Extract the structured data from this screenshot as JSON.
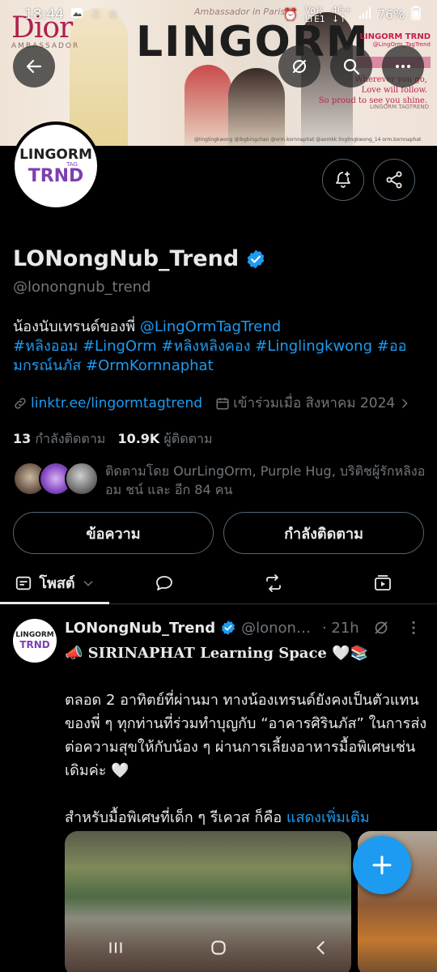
{
  "status_bar": {
    "time": "18:44",
    "signal_text_1": "Vo))",
    "signal_text_2": "LTE1",
    "net_1": "4G+",
    "net_2": "↓↑",
    "battery": "76%"
  },
  "banner": {
    "brand": "Dior",
    "brand_sub": "AMBASSADOR",
    "title": "LINGORM",
    "script": "Ambassador in Paris",
    "logo": "LINGORM TRND",
    "handle": "@LingOrm_TagTrend",
    "quote_lines": [
      "Wherever you go,",
      "Love will follow.",
      "So proud to see you shine."
    ],
    "tag": "LINGORM.TAGTREND",
    "handles": "@linglingkwong   @ibgbingchan   @orm.kornnaphat   @aomkk   linglingkwong_14   orm.kornnaphat"
  },
  "profile": {
    "logo_top": "LINGORM",
    "logo_tag": "TAG",
    "logo_bottom": "TRND",
    "name": "LONongNub_Trend",
    "handle": "@lonongnub_trend",
    "bio_text": "น้องนับเทรนด์ของพี่ ",
    "bio_mention": "@LingOrmTagTrend",
    "bio_tags_line1": "#หลิงออม #LingOrm  #หลิงหลิงคอง #Linglingkwong  #ออ",
    "bio_tags_line2": "มกรณ์นภัส #OrmKornnaphat",
    "link": "linktr.ee/lingormtagtrend",
    "joined": "เข้าร่วมเมื่อ สิงหาคม 2024",
    "following_count": "13",
    "following_label": "กำลังติดตาม",
    "followers_count": "10.9K",
    "followers_label": "ผู้ติดตาม",
    "followed_by": "ติดตามโดย OurLingOrm, Purple Hug, บริติชผู้รักหลิงออม ชน์ และ อีก 84 คน",
    "message_button": "ข้อความ",
    "following_button": "กำลังติดตาม"
  },
  "tabs": {
    "posts": "โพสต์"
  },
  "post": {
    "name": "LONongNub_Trend",
    "handle": "@lonon…",
    "time": "· 21h",
    "title": "📣 SIRINAPHAT Learning Space 🤍📚",
    "para1": "ตลอด 2 อาทิตย์ที่ผ่านมา ทางน้องเทรนด์ยังคงเป็นตัวแทนของพี่ ๆ ทุกท่านที่ร่วมทำบุญกับ “อาคารศิรินภัส” ในการส่งต่อความสุขให้กับน้อง ๆ ผ่านการเลี้ยงอาหารมื้อพิเศษเช่นเดิมค่ะ 🤍",
    "para2": "สำหรับมื้อพิเศษที่เด็ก ๆ รีเควส ก็คือ ",
    "show_more": "แสดงเพิ่มเติม"
  },
  "colors": {
    "accent": "#1d9bf0",
    "bg": "#000000",
    "text": "#e7e9ea",
    "muted": "#71767b"
  }
}
